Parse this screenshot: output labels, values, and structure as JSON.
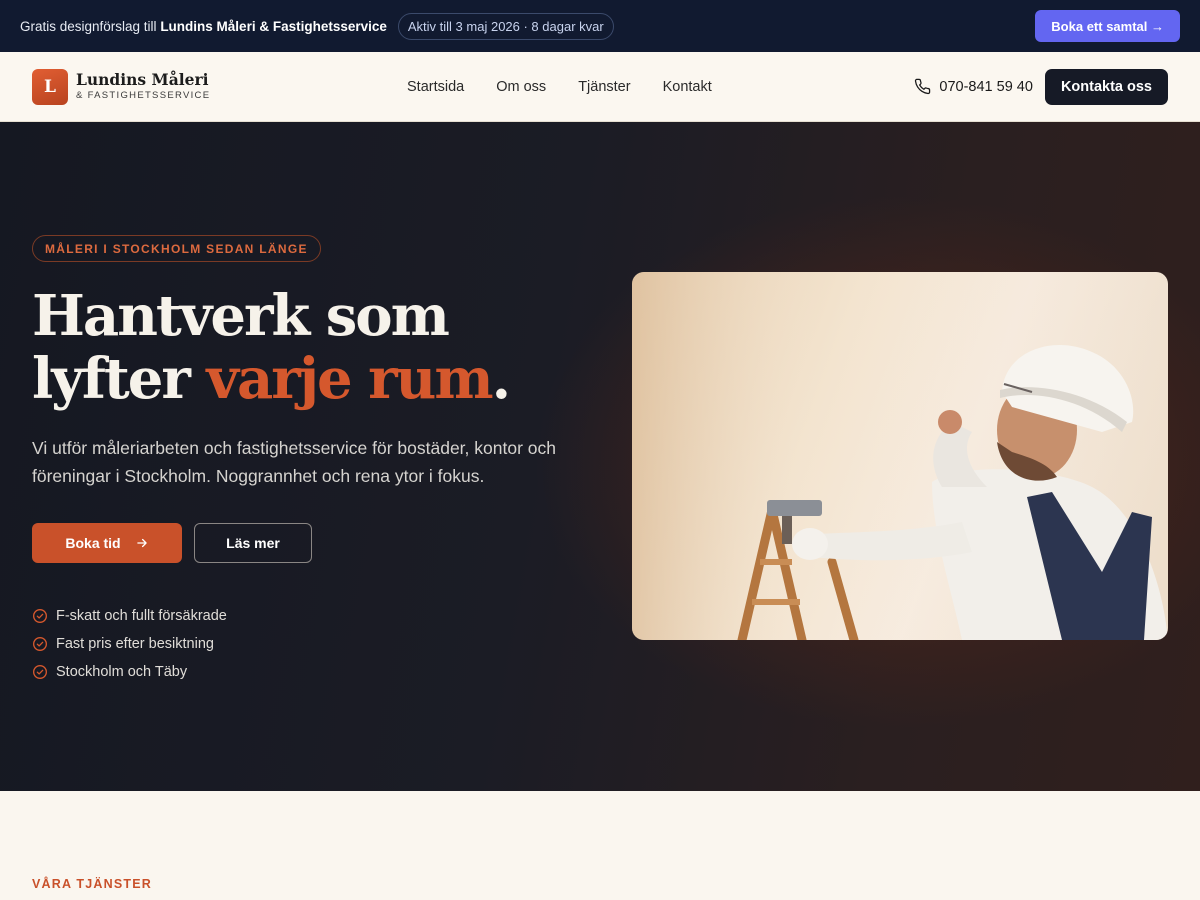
{
  "topbar": {
    "text_prefix": "Gratis designförslag till ",
    "company_bold": "Lundins Måleri & Fastighetsservice",
    "status_pill": "Aktiv till 3 maj 2026 · 8 dagar kvar",
    "cta_label": "Boka ett samtal →"
  },
  "brand": {
    "mark": "L",
    "name": "Lundins Måleri",
    "tagline": "& FASTIGHETSSERVICE"
  },
  "nav": {
    "links": [
      "Startsida",
      "Om oss",
      "Tjänster",
      "Kontakt"
    ],
    "phone": "070-841 59 40",
    "contact_label": "Kontakta oss"
  },
  "hero": {
    "badge": "MÅLERI I STOCKHOLM SEDAN LÄNGE",
    "headline_line1": "Hantverk som",
    "headline_line2_prefix": "lyfter ",
    "headline_accent": "varje rum",
    "headline_suffix": ".",
    "lede": "Vi utför måleriarbeten och fastighetsservice för bostäder, kontor och föreningar i Stockholm. Noggrannhet och rena ytor i fokus.",
    "primary_label": "Boka tid",
    "secondary_label": "Läs mer",
    "features": [
      "F-skatt och fullt försäkrade",
      "Fast pris efter besiktning",
      "Stockholm och Täby"
    ]
  },
  "services": {
    "eyebrow": "VÅRA TJÄNSTER"
  },
  "colors": {
    "accent": "#c9512a",
    "topbar_bg": "#111a30",
    "topbar_cta": "#6366f1",
    "hero_bg": "#1b1c25",
    "cream": "#faf6ef"
  },
  "icons": [
    "phone-icon",
    "arrow-right-icon",
    "check-circle-icon"
  ]
}
